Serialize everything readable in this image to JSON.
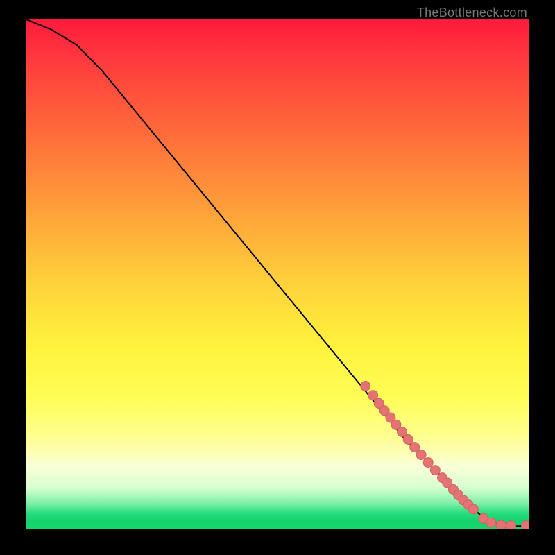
{
  "watermark": "TheBottleneck.com",
  "colors": {
    "background": "#000000",
    "line": "#000000",
    "marker_fill": "#e57373",
    "marker_stroke": "#d06262"
  },
  "chart_data": {
    "type": "line",
    "title": "",
    "xlabel": "",
    "ylabel": "",
    "xlim": [
      0,
      100
    ],
    "ylim": [
      0,
      100
    ],
    "grid": false,
    "series": [
      {
        "name": "curve",
        "x": [
          0,
          5,
          10,
          15,
          20,
          25,
          30,
          35,
          40,
          45,
          50,
          55,
          60,
          65,
          70,
          75,
          80,
          85,
          88,
          90,
          92,
          94,
          96,
          98,
          100
        ],
        "y": [
          100,
          98,
          95,
          90,
          84,
          78,
          72,
          66,
          60,
          54,
          48,
          42,
          36,
          30,
          24,
          18,
          13,
          8,
          5,
          3,
          1.5,
          0.8,
          0.5,
          0.5,
          0.5
        ]
      }
    ],
    "markers": [
      {
        "x": 67.5,
        "y": 28.0
      },
      {
        "x": 69.0,
        "y": 26.2
      },
      {
        "x": 70.2,
        "y": 24.6
      },
      {
        "x": 71.3,
        "y": 23.2
      },
      {
        "x": 72.5,
        "y": 21.8
      },
      {
        "x": 73.6,
        "y": 20.4
      },
      {
        "x": 74.8,
        "y": 19.0
      },
      {
        "x": 76.0,
        "y": 17.5
      },
      {
        "x": 77.3,
        "y": 16.0
      },
      {
        "x": 78.6,
        "y": 14.5
      },
      {
        "x": 80.0,
        "y": 13.0
      },
      {
        "x": 81.4,
        "y": 11.5
      },
      {
        "x": 82.8,
        "y": 10.0
      },
      {
        "x": 83.8,
        "y": 9.0
      },
      {
        "x": 85.0,
        "y": 7.7
      },
      {
        "x": 86.0,
        "y": 6.6
      },
      {
        "x": 87.0,
        "y": 5.6
      },
      {
        "x": 88.0,
        "y": 4.7
      },
      {
        "x": 89.0,
        "y": 3.8
      },
      {
        "x": 91.0,
        "y": 2.0
      },
      {
        "x": 92.5,
        "y": 1.2
      },
      {
        "x": 94.5,
        "y": 0.7
      },
      {
        "x": 96.5,
        "y": 0.6
      },
      {
        "x": 99.5,
        "y": 0.6
      }
    ]
  }
}
